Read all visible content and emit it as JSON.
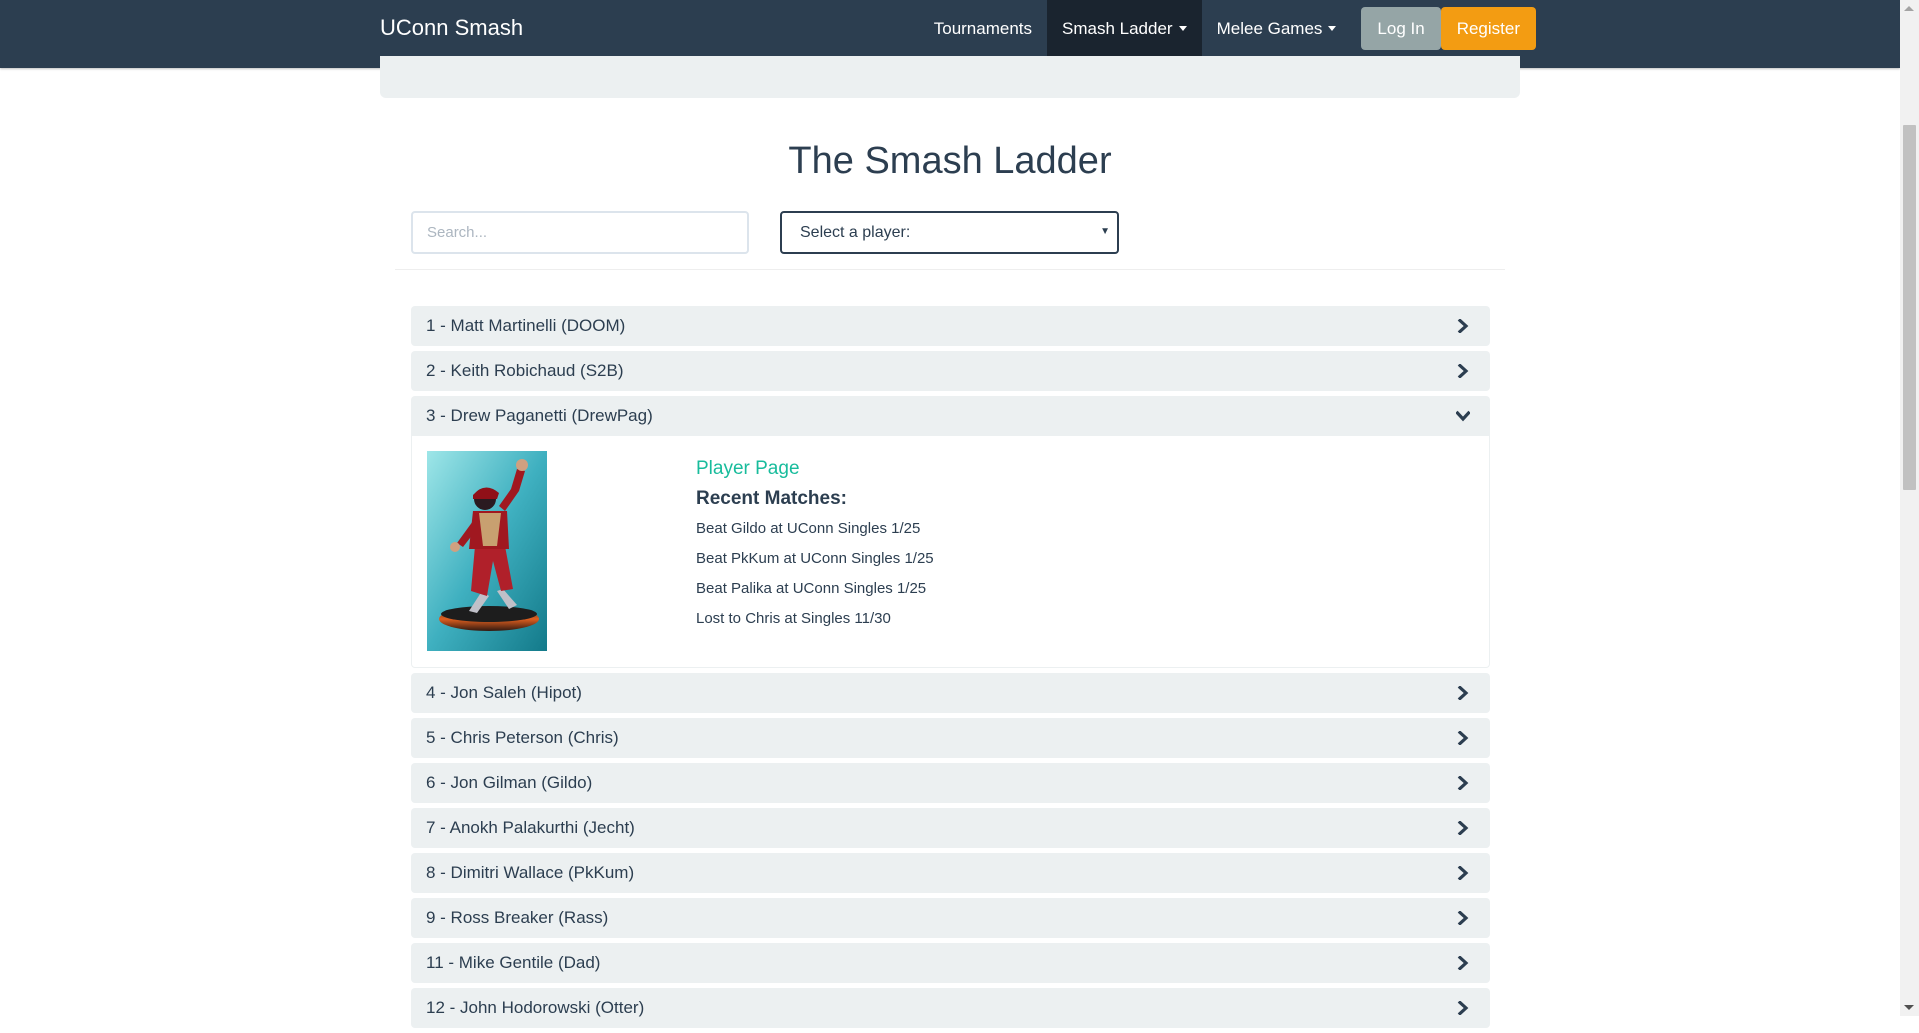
{
  "navbar": {
    "brand": "UConn Smash",
    "items": [
      {
        "label": "Tournaments"
      },
      {
        "label": "Smash Ladder"
      },
      {
        "label": "Melee Games"
      }
    ],
    "login_label": "Log In",
    "register_label": "Register"
  },
  "page": {
    "title": "The Smash Ladder",
    "search_placeholder": "Search...",
    "select_value": "Select a player:"
  },
  "ladder": {
    "players": [
      {
        "label": "1 - Matt Martinelli (DOOM)"
      },
      {
        "label": "2 - Keith Robichaud (S2B)"
      },
      {
        "label": "3 - Drew Paganetti (DrewPag)"
      },
      {
        "label": "4 - Jon Saleh (Hipot)"
      },
      {
        "label": "5 - Chris Peterson (Chris)"
      },
      {
        "label": "6 - Jon Gilman (Gildo)"
      },
      {
        "label": "7 - Anokh Palakurthi (Jecht)"
      },
      {
        "label": "8 - Dimitri Wallace (PkKum)"
      },
      {
        "label": "9 - Ross Breaker (Rass)"
      },
      {
        "label": "11 - Mike Gentile (Dad)"
      },
      {
        "label": "12 - John Hodorowski (Otter)"
      }
    ],
    "expanded": {
      "player_link": "Player Page",
      "recent_title": "Recent Matches:",
      "matches": [
        "Beat Gildo at UConn Singles 1/25",
        "Beat PkKum at UConn Singles 1/25",
        "Beat Palika at UConn Singles 1/25",
        "Lost to Chris at Singles 11/30"
      ]
    }
  },
  "colors": {
    "navbar": "#2c3e50",
    "accent": "#18bc9c",
    "register": "#f39c12",
    "login": "#95a5a6",
    "panel": "#ecf0f1"
  },
  "icons": {
    "collapsed": "chevron-right-icon",
    "expanded": "chevron-down-icon",
    "dropdown": "caret-down-icon"
  }
}
